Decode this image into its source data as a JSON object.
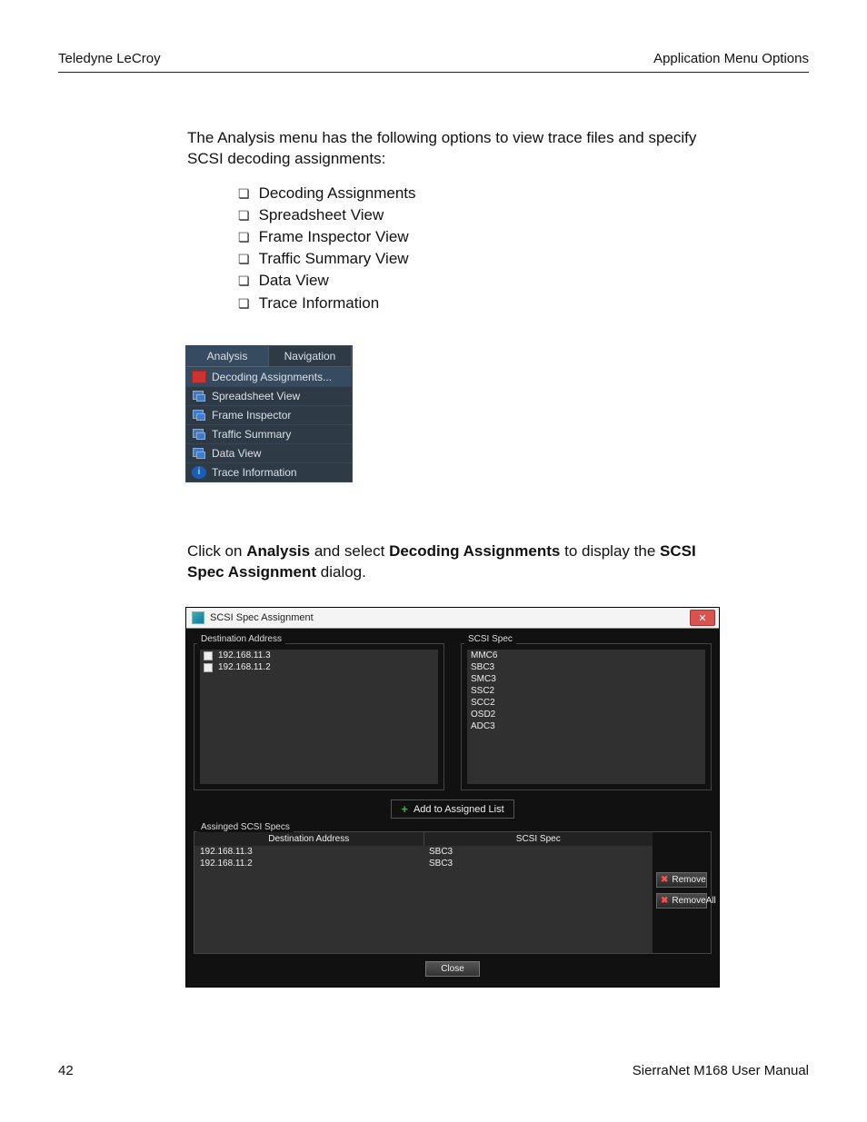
{
  "header": {
    "left": "Teledyne LeCroy",
    "right": "Application Menu Options"
  },
  "intro": "The Analysis menu has the following options to view trace files and specify SCSI decoding assignments:",
  "options": [
    "Decoding Assignments",
    "Spreadsheet View",
    "Frame Inspector View",
    "Traffic Summary View",
    "Data View",
    "Trace Information"
  ],
  "menu": {
    "tabs": {
      "active": "Analysis",
      "other": "Navigation"
    },
    "items": [
      "Decoding Assignments...",
      "Spreadsheet View",
      "Frame Inspector",
      "Traffic Summary",
      "Data View",
      "Trace Information"
    ]
  },
  "para2": {
    "t1": "Click on ",
    "b1": "Analysis",
    "t2": " and select ",
    "b2": "Decoding Assignments",
    "t3": " to display the ",
    "b3": "SCSI Spec Assignment",
    "t4": " dialog."
  },
  "dialog": {
    "title": "SCSI Spec Assignment",
    "close_x": "✕",
    "group_dest": "Destination Address",
    "group_spec": "SCSI Spec",
    "dest_list": [
      "192.168.11.3",
      "192.168.11.2"
    ],
    "spec_list": [
      "MMC6",
      "SBC3",
      "SMC3",
      "SSC2",
      "SCC2",
      "OSD2",
      "ADC3"
    ],
    "add_btn": "Add to Assigned List",
    "group_assigned": "Assinged SCSI Specs",
    "col_dest": "Destination Address",
    "col_spec": "SCSI Spec",
    "assigned": [
      {
        "addr": "192.168.11.3",
        "spec": "SBC3"
      },
      {
        "addr": "192.168.11.2",
        "spec": "SBC3"
      }
    ],
    "remove": "Remove",
    "remove_all": "RemoveAll",
    "close": "Close"
  },
  "footer": {
    "page": "42",
    "doc": "SierraNet M168 User Manual"
  }
}
